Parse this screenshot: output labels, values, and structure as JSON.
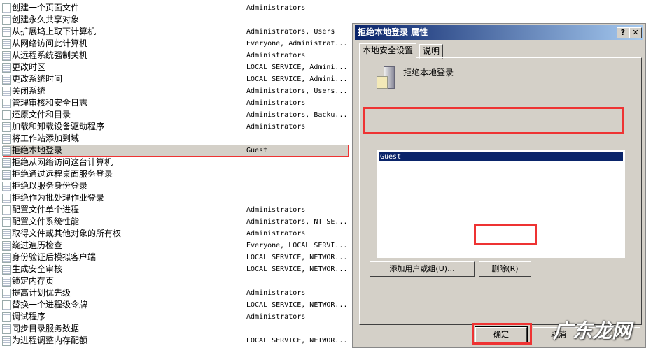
{
  "policies": [
    {
      "name": "创建一个页面文件",
      "value": "Administrators"
    },
    {
      "name": "创建永久共享对象",
      "value": ""
    },
    {
      "name": "从扩展坞上取下计算机",
      "value": "Administrators, Users"
    },
    {
      "name": "从网络访问此计算机",
      "value": "Everyone, Administrat..."
    },
    {
      "name": "从远程系统强制关机",
      "value": "Administrators"
    },
    {
      "name": "更改时区",
      "value": "LOCAL SERVICE, Admini..."
    },
    {
      "name": "更改系统时间",
      "value": "LOCAL SERVICE, Admini..."
    },
    {
      "name": "关闭系统",
      "value": "Administrators, Users..."
    },
    {
      "name": "管理审核和安全日志",
      "value": "Administrators"
    },
    {
      "name": "还原文件和目录",
      "value": "Administrators, Backu..."
    },
    {
      "name": "加载和卸载设备驱动程序",
      "value": "Administrators"
    },
    {
      "name": "将工作站添加到域",
      "value": ""
    },
    {
      "name": "拒绝本地登录",
      "value": "Guest"
    },
    {
      "name": "拒绝从网络访问这台计算机",
      "value": ""
    },
    {
      "name": "拒绝通过远程桌面服务登录",
      "value": ""
    },
    {
      "name": "拒绝以服务身份登录",
      "value": ""
    },
    {
      "name": "拒绝作为批处理作业登录",
      "value": ""
    },
    {
      "name": "配置文件单个进程",
      "value": "Administrators"
    },
    {
      "name": "配置文件系统性能",
      "value": "Administrators, NT SE..."
    },
    {
      "name": "取得文件或其他对象的所有权",
      "value": "Administrators"
    },
    {
      "name": "绕过遍历检查",
      "value": "Everyone, LOCAL SERVI..."
    },
    {
      "name": "身份验证后模拟客户端",
      "value": "LOCAL SERVICE, NETWOR..."
    },
    {
      "name": "生成安全审核",
      "value": "LOCAL SERVICE, NETWOR..."
    },
    {
      "name": "锁定内存页",
      "value": ""
    },
    {
      "name": "提高计划优先级",
      "value": "Administrators"
    },
    {
      "name": "替换一个进程级令牌",
      "value": "LOCAL SERVICE, NETWOR..."
    },
    {
      "name": "调试程序",
      "value": "Administrators"
    },
    {
      "name": "同步目录服务数据",
      "value": ""
    },
    {
      "name": "为进程调整内存配额",
      "value": "LOCAL SERVICE, NETWOR..."
    }
  ],
  "selected_index": 12,
  "dialog": {
    "title": "拒绝本地登录 属性",
    "help": "?",
    "close": "✕",
    "tabs": [
      "本地安全设置",
      "说明"
    ],
    "policy_name": "拒绝本地登录",
    "members": [
      "Guest"
    ],
    "add_button": "添加用户或组(U)...",
    "remove_button": "删除(R)",
    "ok": "确定",
    "cancel": "取消",
    "apply": "应用(A)"
  },
  "watermark": "广东龙网"
}
